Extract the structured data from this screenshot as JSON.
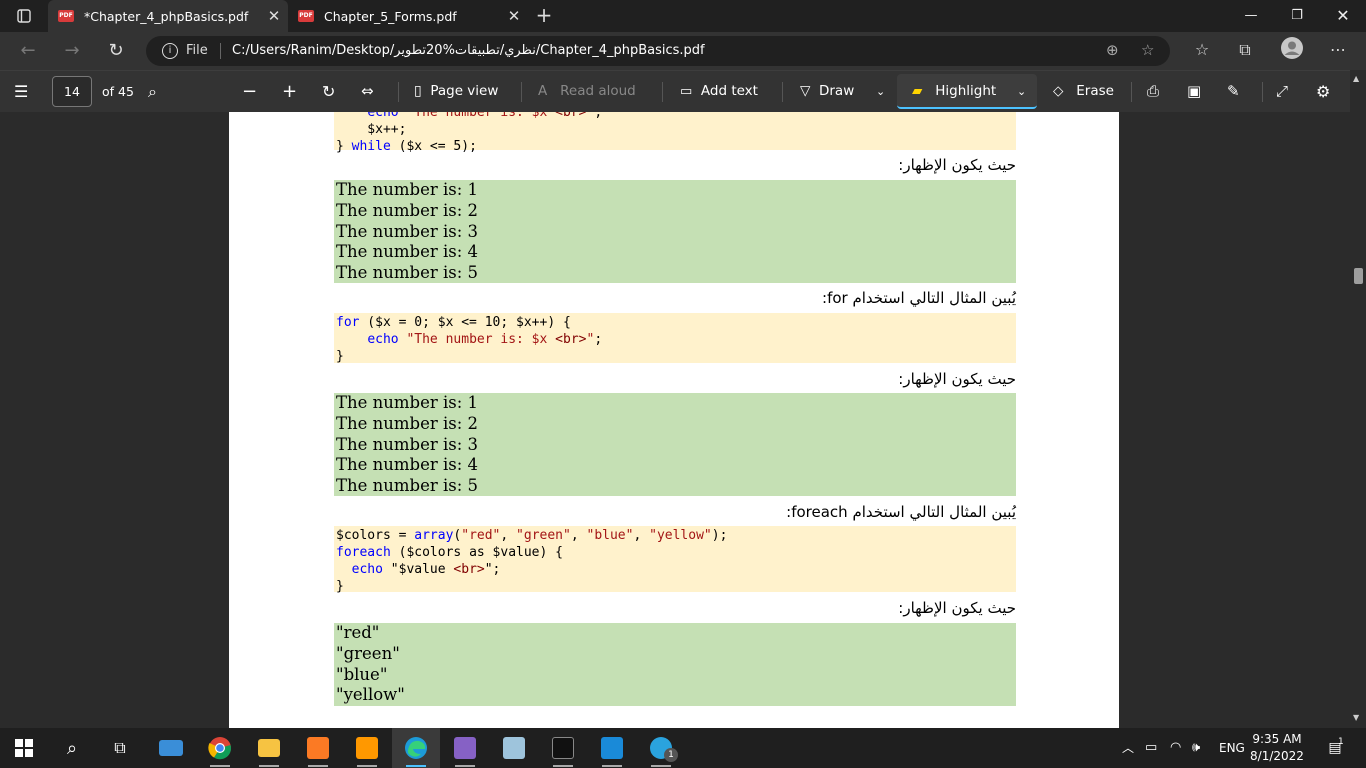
{
  "tabs": [
    {
      "title": "*Chapter_4_phpBasics.pdf",
      "active": true
    },
    {
      "title": "Chapter_5_Forms.pdf",
      "active": false
    }
  ],
  "address": {
    "file_label": "File",
    "url": "C:/Users/Ranim/Desktop/نظري/تطبيقات%20تطوير/Chapter_4_phpBasics.pdf"
  },
  "pdf_toolbar": {
    "page_number": "14",
    "page_total": "of 45",
    "page_view": "Page view",
    "read_aloud": "Read aloud",
    "add_text": "Add text",
    "draw": "Draw",
    "highlight": "Highlight",
    "erase": "Erase"
  },
  "document": {
    "code_top": [
      "    echo \"The number is: $x <br>\";",
      "    $x++;",
      "} while ($x <= 5);"
    ],
    "label_output_1": "حيث يكون الإظهار:",
    "output_1": [
      "The number is: 1",
      "The number is: 2",
      "The number is: 3",
      "The number is: 4",
      "The number is: 5"
    ],
    "label_for": "يُبين المثال التالي استخدام for:",
    "label_output_2": "حيث يكون الإظهار:",
    "output_2": [
      "The number is: 1",
      "The number is: 2",
      "The number is: 3",
      "The number is: 4",
      "The number is: 5"
    ],
    "label_foreach": "يُبين المثال التالي استخدام foreach:",
    "label_output_3": "حيث يكون الإظهار:",
    "output_3": [
      "\"red\"",
      "\"green\"",
      "\"blue\"",
      "\"yellow\""
    ]
  },
  "taskbar": {
    "language": "ENG",
    "time": "9:35 AM",
    "date": "8/1/2022",
    "notification_count": "1",
    "telegram_badge": "1"
  },
  "colors": {
    "code_bg": "#fff2cc",
    "output_bg": "#c5e0b4",
    "keyword": "#0000ff",
    "string": "#a31515",
    "accent": "#4cc2ff"
  }
}
